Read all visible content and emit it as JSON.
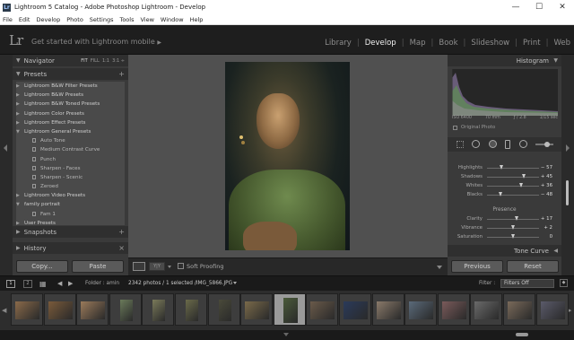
{
  "window": {
    "title": "Lightroom 5 Catalog - Adobe Photoshop Lightroom - Develop",
    "app_icon_label": "Lr",
    "minimize": "—",
    "maximize": "☐",
    "close": "✕"
  },
  "menu": [
    "File",
    "Edit",
    "Develop",
    "Photo",
    "Settings",
    "Tools",
    "View",
    "Window",
    "Help"
  ],
  "identity": {
    "logo": "Lr",
    "tagline": "Get started with Lightroom mobile",
    "arrow": "▶"
  },
  "modules": [
    "Library",
    "Develop",
    "Map",
    "Book",
    "Slideshow",
    "Print",
    "Web"
  ],
  "active_module": "Develop",
  "left_panel": {
    "navigator": {
      "label": "Navigator",
      "zoom_options": [
        "FIT",
        "FILL",
        "1:1",
        "3:1 ÷"
      ]
    },
    "presets": {
      "label": "Presets",
      "add": "+"
    },
    "preset_items": [
      {
        "label": "Lightroom B&W Filter Presets",
        "level": 0,
        "expanded": false
      },
      {
        "label": "Lightroom B&W Presets",
        "level": 0,
        "expanded": false
      },
      {
        "label": "Lightroom B&W Toned Presets",
        "level": 0,
        "expanded": false
      },
      {
        "label": "Lightroom Color Presets",
        "level": 0,
        "expanded": false
      },
      {
        "label": "Lightroom Effect Presets",
        "level": 0,
        "expanded": false
      },
      {
        "label": "Lightroom General Presets",
        "level": 0,
        "expanded": true
      },
      {
        "label": "Auto Tone",
        "level": 1
      },
      {
        "label": "Medium Contrast Curve",
        "level": 1
      },
      {
        "label": "Punch",
        "level": 1
      },
      {
        "label": "Sharpen - Faces",
        "level": 1
      },
      {
        "label": "Sharpen - Scenic",
        "level": 1
      },
      {
        "label": "Zeroed",
        "level": 1
      },
      {
        "label": "Lightroom Video Presets",
        "level": 0,
        "expanded": false
      },
      {
        "label": "family portrait",
        "level": 0,
        "expanded": true
      },
      {
        "label": "Fam 1",
        "level": 1
      },
      {
        "label": "User Presets",
        "level": 0,
        "expanded": false
      }
    ],
    "snapshots": {
      "label": "Snapshots",
      "add": "+"
    },
    "history": {
      "label": "History",
      "close": "×"
    },
    "copy_button": "Copy...",
    "paste_button": "Paste"
  },
  "toolbar": {
    "soft_proofing": "Soft Proofing",
    "soft_proofing_checked": false
  },
  "right_panel": {
    "histogram": {
      "label": "Histogram",
      "iso": "ISO 6400",
      "focal": "70 mm",
      "aperture": "ƒ / 2.8",
      "shutter": "1/15 sec",
      "original_photo": "Original Photo"
    },
    "sliders_top": [
      {
        "label": "Highlights",
        "value": "− 57",
        "pos": 0.28
      },
      {
        "label": "Shadows",
        "value": "+ 45",
        "pos": 0.72
      },
      {
        "label": "Whites",
        "value": "+ 36",
        "pos": 0.66
      },
      {
        "label": "Blacks",
        "value": "− 48",
        "pos": 0.26
      }
    ],
    "presence": {
      "label": "Presence",
      "sliders": [
        {
          "label": "Clarity",
          "value": "+ 17",
          "pos": 0.58
        },
        {
          "label": "Vibrance",
          "value": "+ 2",
          "pos": 0.51
        },
        {
          "label": "Saturation",
          "value": "0",
          "pos": 0.5
        }
      ]
    },
    "tone_curve": "Tone Curve",
    "previous_button": "Previous",
    "reset_button": "Reset"
  },
  "filmstrip_bar": {
    "page1": "1",
    "page2": "2",
    "folder": "Folder : amin",
    "info": "2342 photos / 1 selected /IMG_5866.JPG",
    "filter_label": "Filter :",
    "filter_value": "Filters Off"
  },
  "filmstrip": {
    "count": 17,
    "selected_index": 8
  },
  "colors": {
    "accent_active": "#f0f0f0",
    "panel_bg": "#3a3a3a",
    "preset_highlight": "#4a4a4a"
  }
}
